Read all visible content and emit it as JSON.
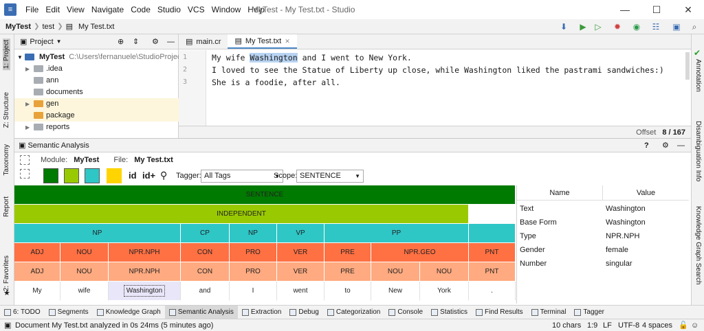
{
  "menu": [
    "File",
    "Edit",
    "View",
    "Navigate",
    "Code",
    "Studio",
    "VCS",
    "Window",
    "Help"
  ],
  "window_title": "MyTest - My Test.txt - Studio",
  "window_controls": {
    "minimize": "—",
    "maximize": "☐",
    "close": "✕"
  },
  "breadcrumb": [
    "MyTest",
    "test",
    "My Test.txt"
  ],
  "left_tabs": [
    "1: Project",
    "Z: Structure",
    "Taxonomy",
    "Report",
    "2: Favorites"
  ],
  "right_tabs": [
    "Annotation",
    "Disambiguation Info",
    "Knowledge Graph Search"
  ],
  "project": {
    "header": "Project",
    "root": {
      "name": "MyTest",
      "path": "C:\\Users\\fernanuele\\StudioProjects\\M"
    },
    "items": [
      {
        "name": ".idea",
        "color": "gray",
        "expandable": true
      },
      {
        "name": "ann",
        "color": "gray",
        "expandable": false
      },
      {
        "name": "documents",
        "color": "gray",
        "expandable": false
      },
      {
        "name": "gen",
        "color": "orange",
        "expandable": true
      },
      {
        "name": "package",
        "color": "orange",
        "expandable": false
      },
      {
        "name": "reports",
        "color": "gray",
        "expandable": true
      }
    ]
  },
  "editor": {
    "tabs": [
      {
        "label": "main.cr",
        "active": false
      },
      {
        "label": "My Test.txt",
        "active": true
      }
    ],
    "lines": [
      {
        "n": "1",
        "before": "My wife ",
        "hl": "Washington",
        "after": " and I went to New York."
      },
      {
        "n": "2",
        "before": "I loved to see the Statue of Liberty up close, while Washington liked the pastrami sandwiches:)",
        "hl": "",
        "after": ""
      },
      {
        "n": "3",
        "before": "She is a foodie, after all.",
        "hl": "",
        "after": ""
      }
    ],
    "offset_label": "Offset",
    "offset_value": "8 / 167"
  },
  "semantic": {
    "title": "Semantic Analysis",
    "module_label": "Module:",
    "module_value": "MyTest",
    "file_label": "File:",
    "file_value": "My Test.txt",
    "swatch_colors": [
      "#007a00",
      "#99c900",
      "#2fc6c6",
      "#ffd400"
    ],
    "tagger_label": "Tagger:",
    "tagger_value": "All Tags",
    "scope_label": "Scope:",
    "scope_value": "SENTENCE",
    "help": "?"
  },
  "grid": {
    "colors": {
      "sentence": "#007a00",
      "independent": "#99c900",
      "phrase": "#2fc6c6",
      "pos": "#ff7043",
      "pos_base": "#ffaa80",
      "word": "#ffffff"
    },
    "sentence": "SENTENCE",
    "independent": "INDEPENDENT",
    "phrases": [
      {
        "label": "NP",
        "span": 3
      },
      {
        "label": "CP",
        "span": 1
      },
      {
        "label": "NP",
        "span": 1
      },
      {
        "label": "VP",
        "span": 1
      },
      {
        "label": "PP",
        "span": 3
      },
      {
        "label": "",
        "span": 1
      }
    ],
    "pos": [
      {
        "label": "ADJ",
        "span": 1
      },
      {
        "label": "NOU",
        "span": 1
      },
      {
        "label": "NPR.NPH",
        "span": 1
      },
      {
        "label": "CON",
        "span": 1
      },
      {
        "label": "PRO",
        "span": 1
      },
      {
        "label": "VER",
        "span": 1
      },
      {
        "label": "PRE",
        "span": 1
      },
      {
        "label": "NPR.GEO",
        "span": 2
      },
      {
        "label": "PNT",
        "span": 1
      }
    ],
    "pos_base": [
      "ADJ",
      "NOU",
      "NPR.NPH",
      "CON",
      "PRO",
      "VER",
      "PRE",
      "NOU",
      "NOU",
      "PNT"
    ],
    "words": [
      "My",
      "wife",
      "Washington",
      "and",
      "I",
      "went",
      "to",
      "New",
      "York",
      "."
    ]
  },
  "properties": {
    "headers": [
      "Name",
      "Value"
    ],
    "rows": [
      {
        "name": "Text",
        "value": "Washington"
      },
      {
        "name": "Base Form",
        "value": "Washington"
      },
      {
        "name": "Type",
        "value": "NPR.NPH"
      },
      {
        "name": "Gender",
        "value": "female"
      },
      {
        "name": "Number",
        "value": "singular"
      }
    ]
  },
  "bottom_tabs": [
    {
      "label": "6: TODO",
      "active": false
    },
    {
      "label": "Segments",
      "active": false
    },
    {
      "label": "Knowledge Graph",
      "active": false
    },
    {
      "label": "Semantic Analysis",
      "active": true
    },
    {
      "label": "Extraction",
      "active": false
    },
    {
      "label": "Debug",
      "active": false
    },
    {
      "label": "Categorization",
      "active": false
    },
    {
      "label": "Console",
      "active": false
    },
    {
      "label": "Statistics",
      "active": false
    },
    {
      "label": "Find Results",
      "active": false
    },
    {
      "label": "Terminal",
      "active": false
    },
    {
      "label": "Tagger",
      "active": false
    }
  ],
  "status": {
    "message": "Document My Test.txt analyzed in 0s 24ms (5 minutes ago)",
    "chars": "10 chars",
    "position": "1:9",
    "line_sep": "LF",
    "encoding": "UTF-8",
    "indent": "4 spaces"
  }
}
